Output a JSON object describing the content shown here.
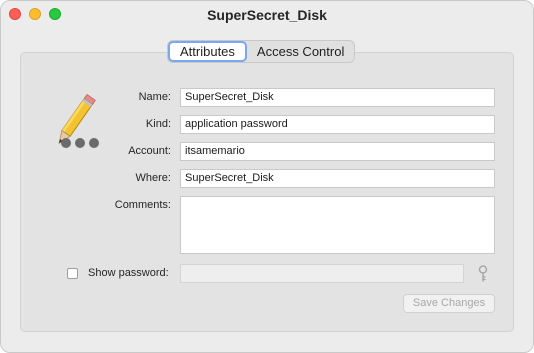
{
  "window": {
    "title": "SuperSecret_Disk"
  },
  "tabs": [
    {
      "label": "Attributes",
      "selected": true
    },
    {
      "label": "Access Control",
      "selected": false
    }
  ],
  "form": {
    "name": {
      "label": "Name:",
      "value": "SuperSecret_Disk"
    },
    "kind": {
      "label": "Kind:",
      "value": "application password"
    },
    "account": {
      "label": "Account:",
      "value": "itsamemario"
    },
    "where": {
      "label": "Where:",
      "value": "SuperSecret_Disk"
    },
    "comments": {
      "label": "Comments:",
      "value": ""
    },
    "show_password": {
      "label": "Show password:",
      "checked": false,
      "value": ""
    }
  },
  "buttons": {
    "save_changes": "Save Changes"
  },
  "icons": {
    "item": "pencil-password-icon",
    "key": "key-icon"
  }
}
